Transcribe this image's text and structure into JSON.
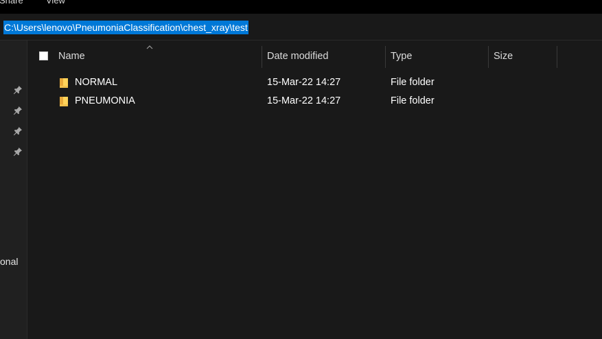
{
  "ribbon": {
    "share_label": "Share",
    "view_label": "View"
  },
  "address_bar": {
    "path": "C:\\Users\\lenovo\\PneumoniaClassification\\chest_xray\\test"
  },
  "nav_pane": {
    "pin_icon": "pin-icon",
    "partial_label": "onal"
  },
  "columns": {
    "name": "Name",
    "date": "Date modified",
    "type": "Type",
    "size": "Size"
  },
  "colors": {
    "background": "#191919",
    "selection": "#0078d7",
    "folder": "#ffd35a"
  },
  "files": [
    {
      "name": "NORMAL",
      "date": "15-Mar-22 14:27",
      "type": "File folder",
      "size": ""
    },
    {
      "name": "PNEUMONIA",
      "date": "15-Mar-22 14:27",
      "type": "File folder",
      "size": ""
    }
  ]
}
